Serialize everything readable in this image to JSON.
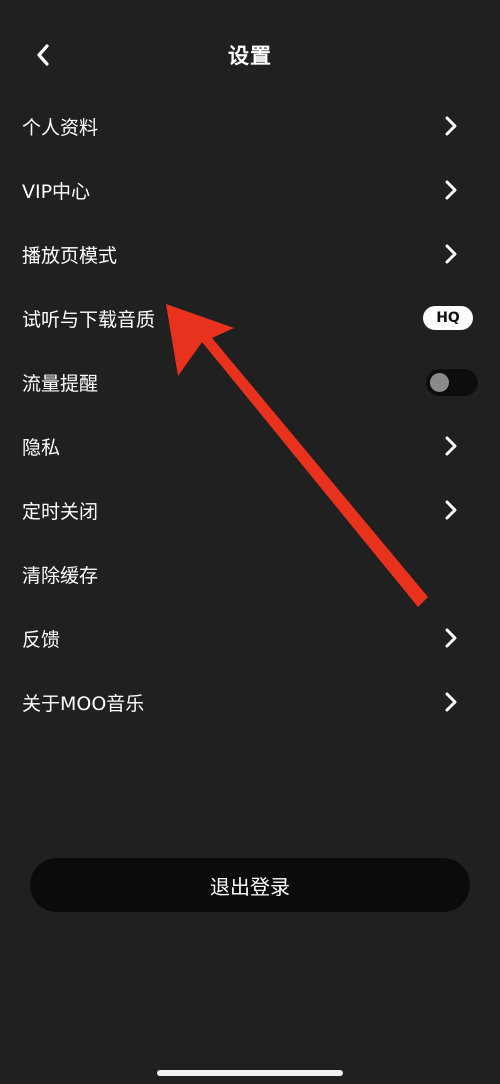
{
  "header": {
    "title": "设置",
    "back_icon": "chevron-left-icon"
  },
  "settings": {
    "items": [
      {
        "label": "个人资料",
        "trailing": "chevron"
      },
      {
        "label": "VIP中心",
        "trailing": "chevron"
      },
      {
        "label": "播放页模式",
        "trailing": "chevron"
      },
      {
        "label": "试听与下载音质",
        "trailing": "badge",
        "badge": "HQ"
      },
      {
        "label": "流量提醒",
        "trailing": "toggle",
        "toggle_on": false
      },
      {
        "label": "隐私",
        "trailing": "chevron"
      },
      {
        "label": "定时关闭",
        "trailing": "chevron"
      },
      {
        "label": "清除缓存",
        "trailing": "none"
      },
      {
        "label": "反馈",
        "trailing": "chevron"
      },
      {
        "label": "关于MOO音乐",
        "trailing": "chevron"
      }
    ]
  },
  "logout": {
    "label": "退出登录"
  },
  "colors": {
    "background": "#202020",
    "button": "#0b0b0b",
    "annotation_arrow": "#e8321e"
  }
}
